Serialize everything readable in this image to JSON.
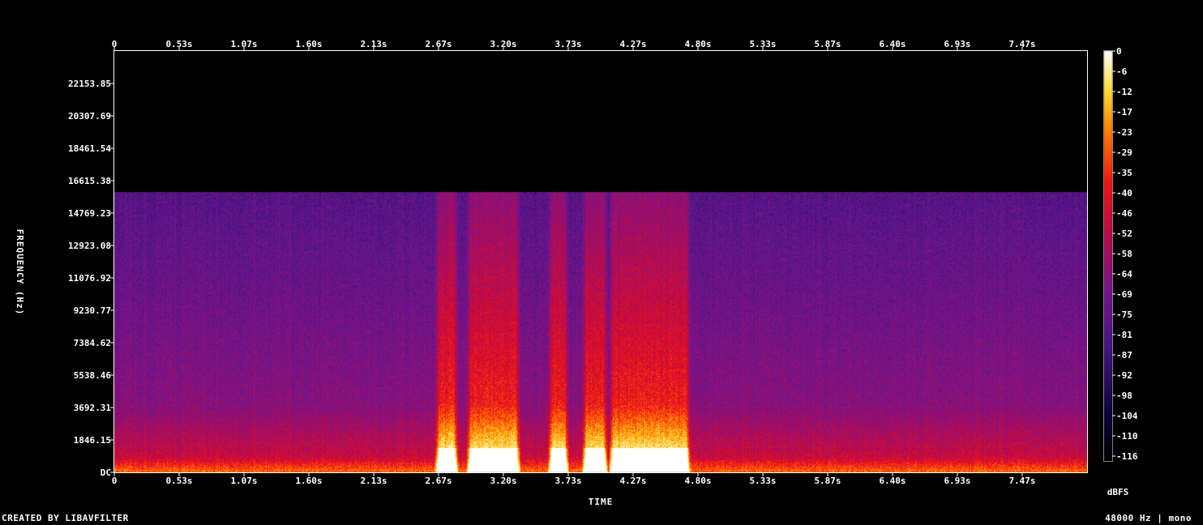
{
  "chart_data": {
    "type": "heatmap",
    "title": "",
    "xlabel": "TIME",
    "ylabel": "FREQUENCY (Hz)",
    "x_ticks": [
      "0",
      "0.53s",
      "1.07s",
      "1.60s",
      "2.13s",
      "2.67s",
      "3.20s",
      "3.73s",
      "4.27s",
      "4.80s",
      "5.33s",
      "5.87s",
      "6.40s",
      "6.93s",
      "7.47s"
    ],
    "y_ticks": [
      "DC",
      "1846.15",
      "3692.31",
      "5538.46",
      "7384.62",
      "9230.77",
      "11076.92",
      "12923.08",
      "14769.23",
      "16615.38",
      "18461.54",
      "20307.69",
      "22153.85"
    ],
    "xlim": [
      0,
      8.0
    ],
    "ylim": [
      0,
      24000
    ],
    "colorbar": {
      "label": "dBFS",
      "ticks": [
        "0",
        "-6",
        "-12",
        "-17",
        "-23",
        "-29",
        "-35",
        "-40",
        "-46",
        "-52",
        "-58",
        "-64",
        "-69",
        "-75",
        "-81",
        "-87",
        "-92",
        "-98",
        "-104",
        "-110",
        "-116"
      ],
      "range": [
        -120,
        0
      ]
    },
    "content_cutoff_hz": 16000,
    "loud_segments_s": [
      {
        "start": 2.67,
        "end": 2.79
      },
      {
        "start": 2.93,
        "end": 3.3
      },
      {
        "start": 3.6,
        "end": 3.7
      },
      {
        "start": 3.88,
        "end": 4.02
      },
      {
        "start": 4.1,
        "end": 4.7
      }
    ]
  },
  "footer": {
    "left": "CREATED BY LIBAVFILTER",
    "right": "48000 Hz | mono"
  },
  "colors": {
    "background": "#000000",
    "text": "#ffffff"
  }
}
